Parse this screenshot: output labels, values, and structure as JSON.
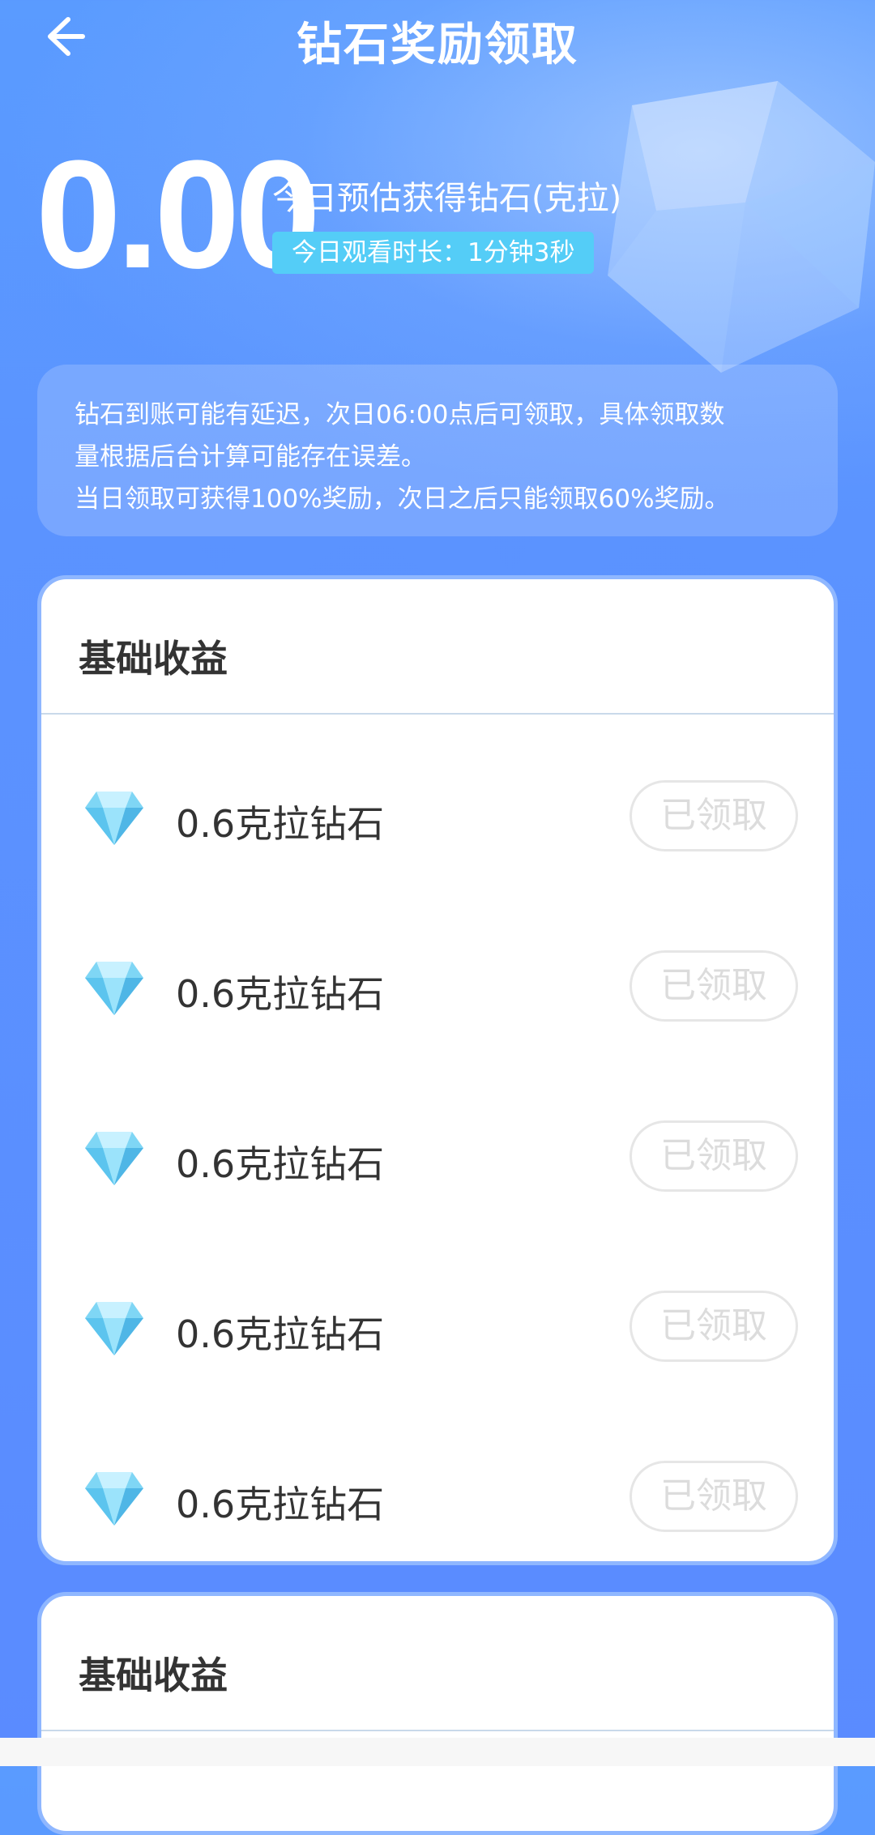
{
  "header": {
    "title": "钻石奖励领取",
    "back_icon": "arrow-left-icon"
  },
  "summary": {
    "amount": "0.00",
    "amount_label": "今日预估获得钻石(克拉)",
    "watch_time": "今日观看时长：1分钟3秒"
  },
  "notice": {
    "lines": [
      "钻石到账可能有延迟，次日06:00点后可领取，具体领取数",
      "量根据后台计算可能存在误差。",
      "当日领取可获得100%奖励，次日之后只能领取60%奖励。"
    ]
  },
  "sections": [
    {
      "title": "基础收益",
      "items": [
        {
          "label": "0.6克拉钻石",
          "button": "已领取"
        },
        {
          "label": "0.6克拉钻石",
          "button": "已领取"
        },
        {
          "label": "0.6克拉钻石",
          "button": "已领取"
        },
        {
          "label": "0.6克拉钻石",
          "button": "已领取"
        },
        {
          "label": "0.6克拉钻石",
          "button": "已领取"
        }
      ]
    },
    {
      "title": "基础收益",
      "items": []
    }
  ],
  "colors": {
    "background": "#5a93ff",
    "badge": "#54cdf7",
    "card_border": "#8fb7ff",
    "claimed_text": "#dcdcdc",
    "gem": "#7fd6f5"
  },
  "icons": {
    "gem": "diamond-icon"
  }
}
